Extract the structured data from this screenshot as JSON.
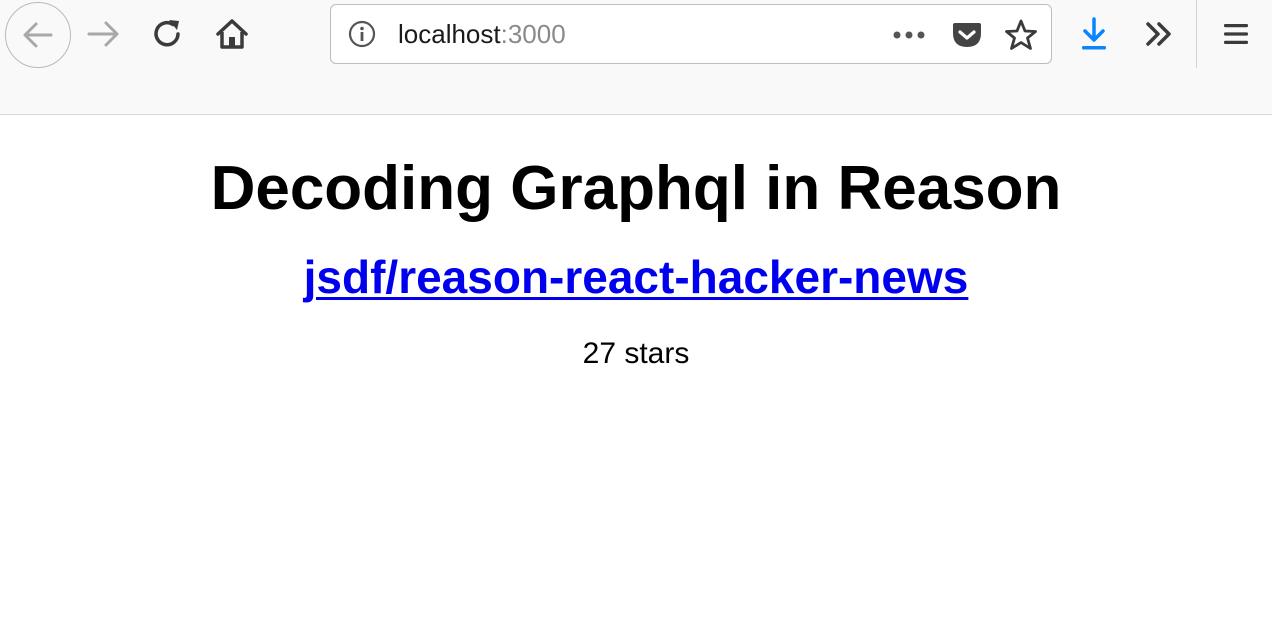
{
  "browser": {
    "url": {
      "host": "localhost",
      "port": ":3000"
    },
    "icons": {
      "back": "arrow-left-icon",
      "forward": "arrow-right-icon",
      "reload": "reload-icon",
      "home": "home-icon",
      "info": "info-icon",
      "more": "more-dots-icon",
      "pocket": "pocket-icon",
      "bookmark": "star-icon",
      "download": "download-icon",
      "overflow": "chevron-double-right-icon",
      "menu": "hamburger-menu-icon"
    },
    "colors": {
      "toolbar_bg": "#f9f9f9",
      "download_accent": "#0a84ff",
      "icon": "#3b3b3b",
      "icon_disabled": "#a8a8a8"
    }
  },
  "page": {
    "title": "Decoding Graphql in Reason",
    "repo_link": "jsdf/reason-react-hacker-news",
    "stars": "27 stars",
    "colors": {
      "link": "#0000ee",
      "text": "#000000"
    }
  }
}
